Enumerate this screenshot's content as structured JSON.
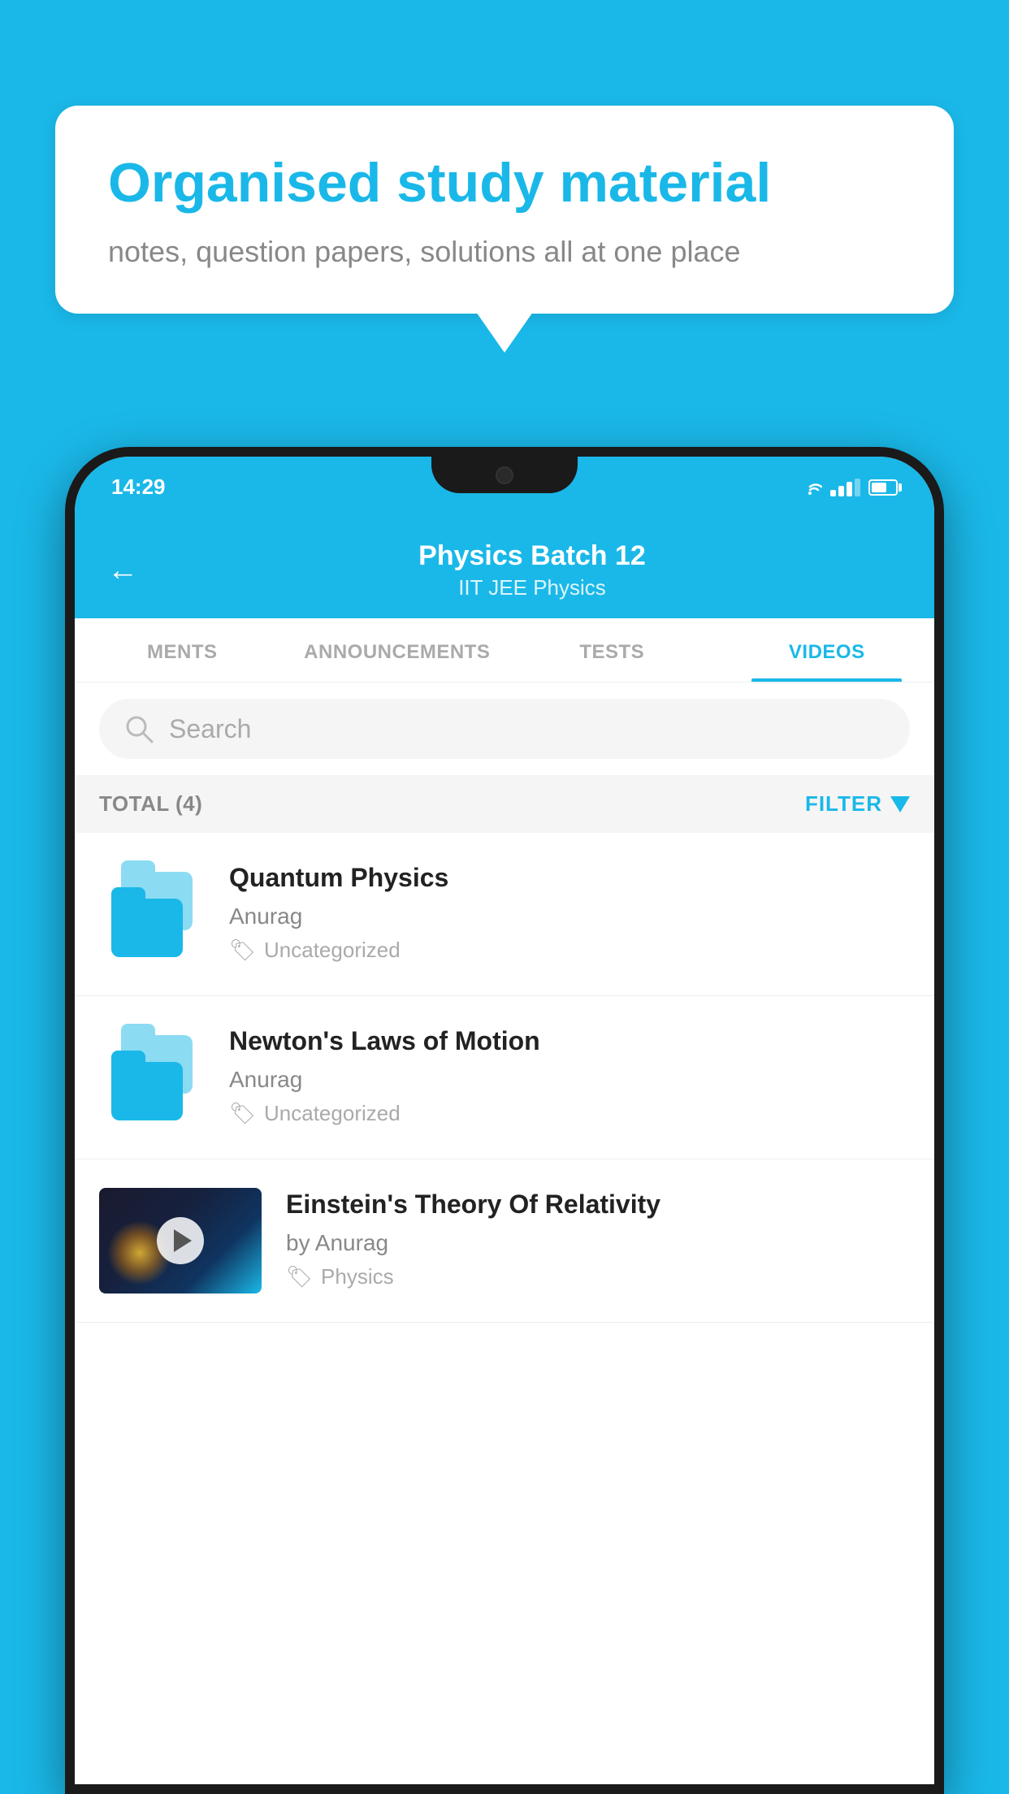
{
  "background_color": "#1ab8e8",
  "speech_bubble": {
    "title": "Organised study material",
    "subtitle": "notes, question papers, solutions all at one place"
  },
  "status_bar": {
    "time": "14:29"
  },
  "app_header": {
    "title": "Physics Batch 12",
    "subtitle": "IIT JEE    Physics",
    "back_label": "←"
  },
  "tabs": [
    {
      "label": "MENTS",
      "active": false
    },
    {
      "label": "ANNOUNCEMENTS",
      "active": false
    },
    {
      "label": "TESTS",
      "active": false
    },
    {
      "label": "VIDEOS",
      "active": true
    }
  ],
  "search": {
    "placeholder": "Search"
  },
  "filter_bar": {
    "total_label": "TOTAL (4)",
    "filter_label": "FILTER"
  },
  "videos": [
    {
      "title": "Quantum Physics",
      "author": "Anurag",
      "tag": "Uncategorized",
      "has_thumbnail": false
    },
    {
      "title": "Newton's Laws of Motion",
      "author": "Anurag",
      "tag": "Uncategorized",
      "has_thumbnail": false
    },
    {
      "title": "Einstein's Theory Of Relativity",
      "author": "by Anurag",
      "tag": "Physics",
      "has_thumbnail": true
    }
  ]
}
